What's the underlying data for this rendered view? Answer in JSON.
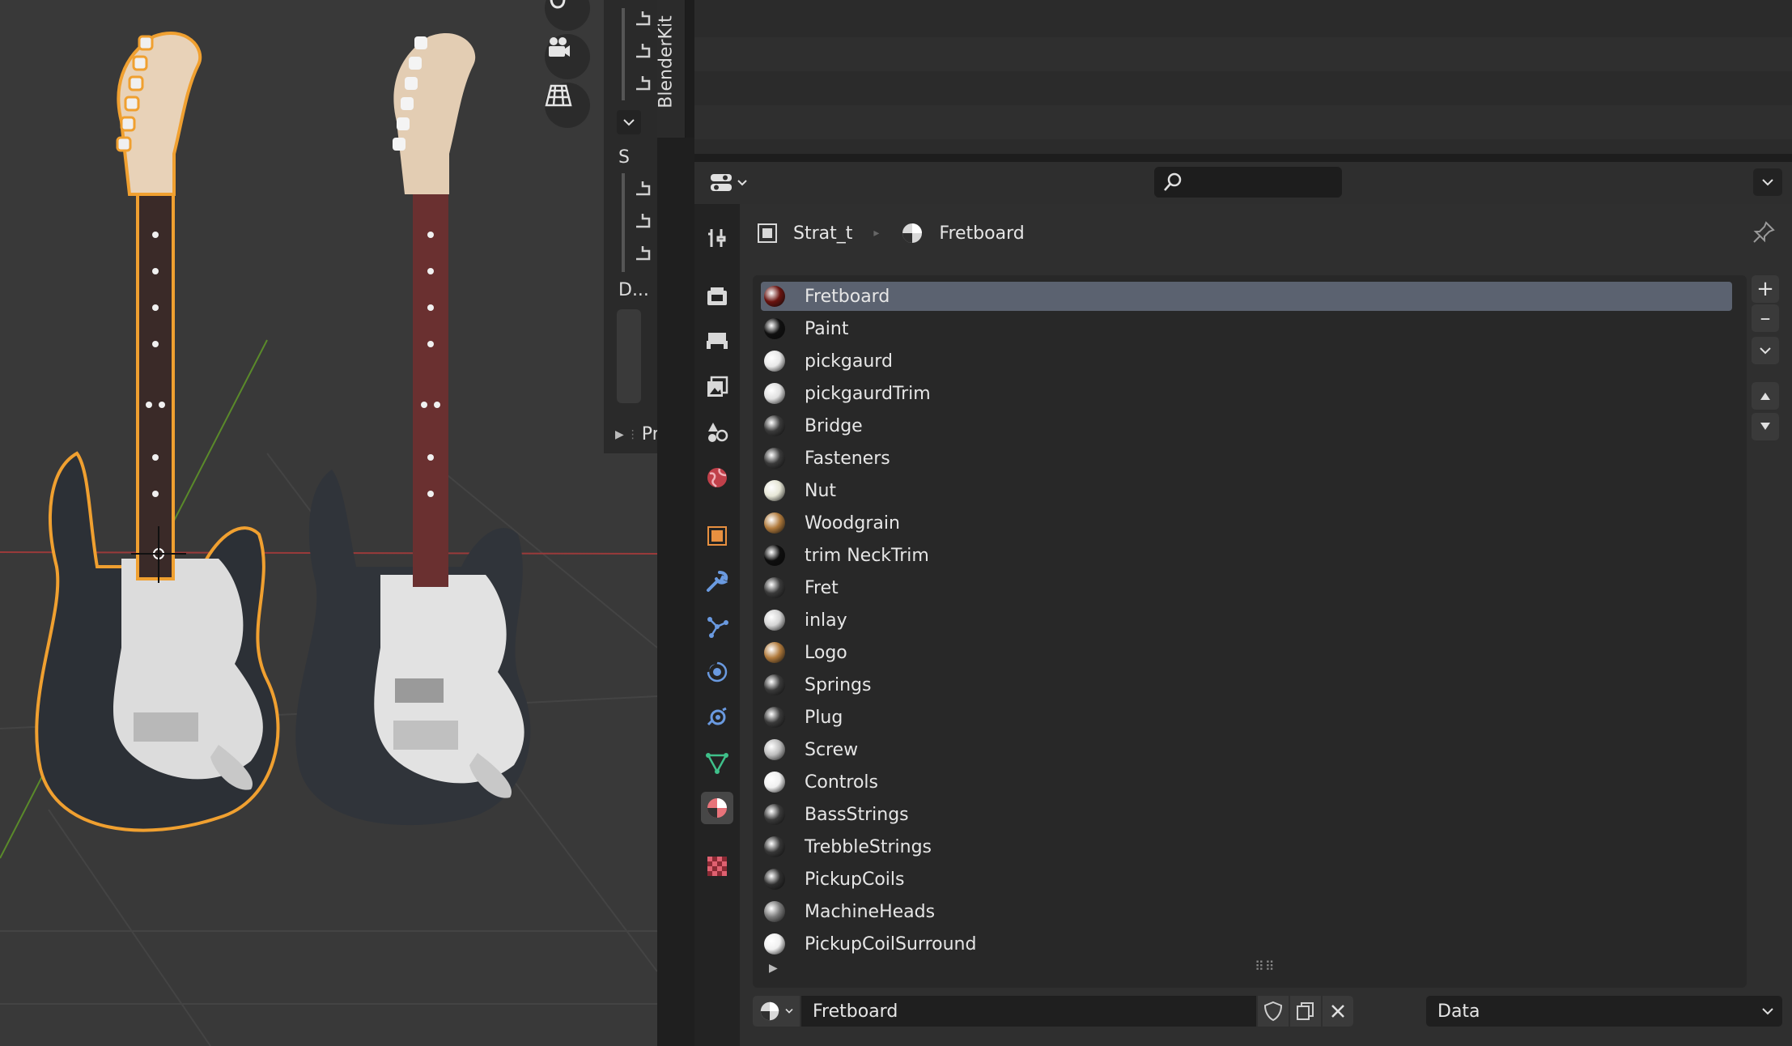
{
  "viewport": {
    "nav_icons": [
      "hand-icon",
      "camera-icon",
      "grid-icon"
    ]
  },
  "outliner": {
    "section_s": "S",
    "section_d": "D...",
    "panel_label": "Pr"
  },
  "blenderkit": {
    "tab_label": "BlenderKit"
  },
  "properties": {
    "breadcrumb": {
      "object": "Strat_t",
      "material": "Fretboard"
    },
    "materials": [
      {
        "name": "Fretboard",
        "color": "#6a1410",
        "selected": true
      },
      {
        "name": "Paint",
        "color": "#101010"
      },
      {
        "name": "pickgaurd",
        "color": "#e8e8e8"
      },
      {
        "name": "pickgaurdTrim",
        "color": "#e0e0e0"
      },
      {
        "name": "Bridge",
        "color": "#3a3a3a"
      },
      {
        "name": "Fasteners",
        "color": "#3a3a3a"
      },
      {
        "name": "Nut",
        "color": "#e6e6d6"
      },
      {
        "name": "Woodgrain",
        "color": "#b07a3c"
      },
      {
        "name": "trim NeckTrim",
        "color": "#0e0e0e"
      },
      {
        "name": "Fret",
        "color": "#3a3a3a"
      },
      {
        "name": "inlay",
        "color": "#d4d4d4"
      },
      {
        "name": "Logo",
        "color": "#b07a3c"
      },
      {
        "name": "Springs",
        "color": "#3a3a3a"
      },
      {
        "name": "Plug",
        "color": "#3a3a3a"
      },
      {
        "name": "Screw",
        "color": "#bdbdbd"
      },
      {
        "name": "Controls",
        "color": "#f0f0f0"
      },
      {
        "name": "BassStrings",
        "color": "#3a3a3a"
      },
      {
        "name": "TrebbleStrings",
        "color": "#363636"
      },
      {
        "name": "PickupCoils",
        "color": "#2f2f2f"
      },
      {
        "name": "MachineHeads",
        "color": "#7a7a7a"
      },
      {
        "name": "PickupCoilSurround",
        "color": "#f0f0f0"
      }
    ],
    "datablock_name": "Fretboard",
    "link_mode": "Data"
  },
  "colors": {
    "selection": "#5b6270",
    "outline_orange": "#f0a030",
    "material_tab_accent": "#e8737a"
  }
}
